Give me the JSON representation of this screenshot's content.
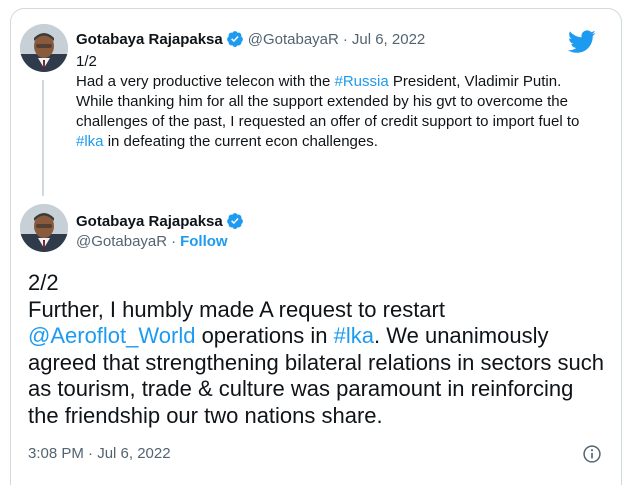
{
  "tweet1": {
    "display_name": "Gotabaya Rajapaksa",
    "handle": "@GotabayaR",
    "separator": "·",
    "date": "Jul 6, 2022",
    "text_parts": [
      {
        "text": "1/2\nHad a very productive telecon with the ",
        "type": "plain"
      },
      {
        "text": "#Russia",
        "type": "hashtag"
      },
      {
        "text": " President, Vladimir Putin. While thanking him for all the support extended by his gvt to overcome the challenges of the past, I requested an offer of credit support to import fuel to ",
        "type": "plain"
      },
      {
        "text": "#lka",
        "type": "hashtag"
      },
      {
        "text": " in defeating the current econ challenges.",
        "type": "plain"
      }
    ]
  },
  "tweet2": {
    "display_name": "Gotabaya Rajapaksa",
    "handle": "@GotabayaR",
    "separator": "·",
    "follow_label": "Follow",
    "text_parts": [
      {
        "text": "2/2\nFurther, I humbly made A request to restart\n",
        "type": "plain"
      },
      {
        "text": "@Aeroflot_World",
        "type": "mention"
      },
      {
        "text": " operations in ",
        "type": "plain"
      },
      {
        "text": "#lka",
        "type": "hashtag"
      },
      {
        "text": ". We unanimously agreed that strengthening bilateral relations in sectors such as tourism, trade & culture was paramount in reinforcing the friendship our two nations share.",
        "type": "plain"
      }
    ],
    "timestamp": "3:08 PM · Jul 6, 2022"
  },
  "icons": {
    "verified": "verified-badge-icon",
    "logo": "twitter-bird-icon",
    "info": "info-icon"
  },
  "colors": {
    "accent": "#1d9bf0",
    "text": "#0f1419",
    "secondary": "#536471",
    "border": "#cfd9de"
  }
}
